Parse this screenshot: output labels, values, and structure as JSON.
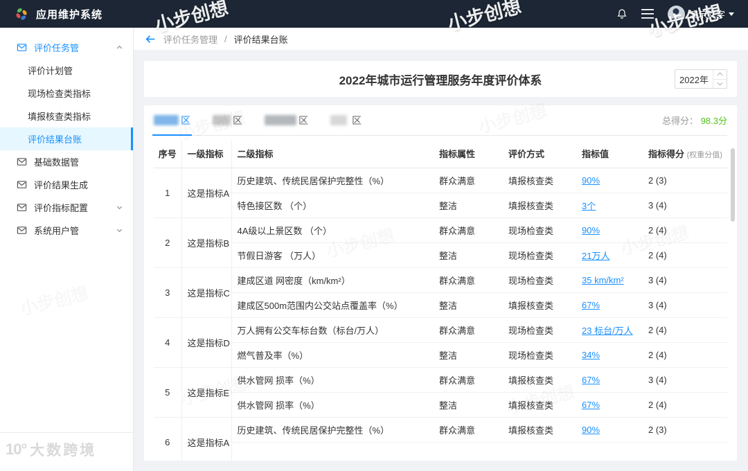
{
  "topbar": {
    "app_title": "应用维护系统",
    "user_name": "演示文字"
  },
  "breadcrumb": {
    "parent": "评价任务管理",
    "separator": "/",
    "current": "评价结果台账"
  },
  "title_card": {
    "title": "2022年城市运行管理服务年度评价体系",
    "year_value": "2022年"
  },
  "tabs": {
    "items": [
      {
        "label": "区",
        "redacted": true,
        "active": true
      },
      {
        "label": "区",
        "redacted": true,
        "active": false
      },
      {
        "label": "区",
        "redacted": true,
        "active": false
      },
      {
        "label": "区",
        "redacted": true,
        "active": false
      }
    ]
  },
  "score": {
    "label": "总得分：",
    "value": "98.3分"
  },
  "table": {
    "columns": [
      "序号",
      "一级指标",
      "二级指标",
      "指标属性",
      "评价方式",
      "指标值",
      "指标得分"
    ],
    "score_note": "(权重分值)",
    "groups": [
      {
        "no": "1",
        "level1": "这是指标A",
        "rows": [
          {
            "name": "历史建筑、传统民居保护完整性（%）",
            "attr": "群众满意",
            "method": "填报核查类",
            "value": "90%",
            "score": "2 (3)"
          },
          {
            "name": "特色接区数 （个）",
            "attr": "整洁",
            "method": "填报核查类",
            "value": "3个",
            "score": "3 (4)"
          }
        ]
      },
      {
        "no": "2",
        "level1": "这是指标B",
        "rows": [
          {
            "name": "4A级以上景区数 （个）",
            "attr": "群众满意",
            "method": "现场检查类",
            "value": "90%",
            "score": "2 (4)"
          },
          {
            "name": "节假日游客 （万人）",
            "attr": "整洁",
            "method": "现场检查类",
            "value": "21万人",
            "score": "2 (4)"
          }
        ]
      },
      {
        "no": "3",
        "level1": "这是指标C",
        "rows": [
          {
            "name": "建成区道 网密度（km/km²）",
            "attr": "群众满意",
            "method": "现场检查类",
            "value": "35 km/km²",
            "score": "3 (4)"
          },
          {
            "name": "建成区500m范围内公交站点覆盖率（%）",
            "attr": "整洁",
            "method": "填报核查类",
            "value": "67%",
            "score": "3 (4)"
          }
        ]
      },
      {
        "no": "4",
        "level1": "这是指标D",
        "rows": [
          {
            "name": "万人拥有公交车标台数（标台/万人）",
            "attr": "群众满意",
            "method": "现场检查类",
            "value": "23 标台/万人",
            "score": "2 (4)"
          },
          {
            "name": "燃气普及率（%）",
            "attr": "整洁",
            "method": "现场检查类",
            "value": "34%",
            "score": "2 (4)"
          }
        ]
      },
      {
        "no": "5",
        "level1": "这是指标E",
        "rows": [
          {
            "name": "供水管网 损率（%）",
            "attr": "群众满意",
            "method": "填报核查类",
            "value": "67%",
            "score": "3 (4)"
          },
          {
            "name": "供水管网 损率（%）",
            "attr": "整洁",
            "method": "填报核查类",
            "value": "67%",
            "score": "2 (4)"
          }
        ]
      },
      {
        "no": "6",
        "level1": "这是指标A",
        "rows": [
          {
            "name": "历史建筑、传统民居保护完整性（%）",
            "attr": "群众满意",
            "method": "填报核查类",
            "value": "90%",
            "score": "2 (3)"
          },
          {
            "name": "",
            "attr": "",
            "method": "",
            "value": "",
            "score": ""
          }
        ]
      }
    ]
  },
  "sidebar": {
    "items": [
      {
        "kind": "parent",
        "label": "评价任务管",
        "accent": true,
        "chevron": "up"
      },
      {
        "kind": "child",
        "label": "评价计划管"
      },
      {
        "kind": "child",
        "label": "现场检查类指标"
      },
      {
        "kind": "child",
        "label": "填报核查类指标"
      },
      {
        "kind": "child",
        "label": "评价结果台账",
        "active": true
      },
      {
        "kind": "parent",
        "label": "基础数据管"
      },
      {
        "kind": "parent",
        "label": "评价结果生成"
      },
      {
        "kind": "parent",
        "label": "评价指标配置",
        "chevron": "down"
      },
      {
        "kind": "parent",
        "label": "系统用户管",
        "chevron": "down"
      }
    ]
  },
  "watermarks": {
    "brand": "小步创想",
    "footer_logo": "10°",
    "footer": "大数跨境"
  },
  "colors": {
    "accent": "#1890ff",
    "score_green": "#52c41a",
    "topbar_bg": "#1c2634"
  }
}
